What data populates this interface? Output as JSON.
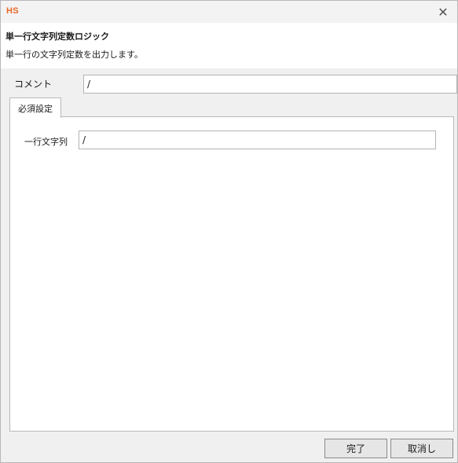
{
  "window": {
    "logo_text": "HS",
    "logo_color": "#e8692a",
    "close_glyph": "✕"
  },
  "header": {
    "title": "単一行文字列定数ロジック",
    "description": "単一行の文字列定数を出力します。"
  },
  "comment": {
    "label": "コメント",
    "value": "/"
  },
  "tabs": [
    {
      "label": "必須設定",
      "selected": true
    }
  ],
  "required_settings": {
    "field_label": "一行文字列",
    "field_value": "/"
  },
  "buttons": {
    "ok_label": "完了",
    "cancel_label": "取消し"
  }
}
